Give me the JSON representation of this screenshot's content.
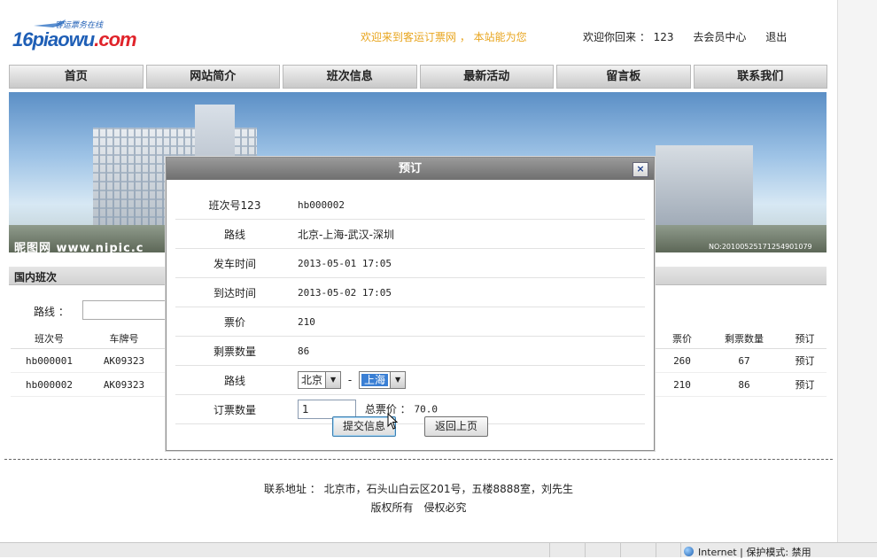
{
  "header": {
    "logo_main": "16piaowu",
    "logo_suffix": ".com",
    "logo_tagline": "客运票务在线",
    "welcome_text": "欢迎来到客运订票网 ， 本站能为您",
    "greeting": "欢迎你回来 ： 123",
    "member_center": "去会员中心",
    "logout": "退出"
  },
  "nav": [
    "首页",
    "网站简介",
    "班次信息",
    "最新活动",
    "留言板",
    "联系我们"
  ],
  "banner": {
    "watermark_left": "昵图网 www.nipic.c",
    "watermark_right": "NO:20100525171254901079"
  },
  "section": {
    "title": "国内班次",
    "route_label": "路线 ："
  },
  "table": {
    "headers": [
      "班次号",
      "车牌号",
      "票价",
      "剩票数量",
      "预订"
    ],
    "rows": [
      {
        "id": "hb000001",
        "plate": "AK09323",
        "price": "260",
        "remaining": "67",
        "book": "预订"
      },
      {
        "id": "hb000002",
        "plate": "AK09323",
        "price": "210",
        "remaining": "86",
        "book": "预订"
      }
    ]
  },
  "dialog": {
    "title": "预订",
    "close": "×",
    "fields": [
      {
        "label": "班次号123",
        "value": "hb000002"
      },
      {
        "label": "路线",
        "value": "北京-上海-武汉-深圳"
      },
      {
        "label": "发车时间",
        "value": "2013-05-01 17:05"
      },
      {
        "label": "到达时间",
        "value": "2013-05-02 17:05"
      },
      {
        "label": "票价",
        "value": "210"
      },
      {
        "label": "剩票数量",
        "value": "86"
      }
    ],
    "route_label": "路线",
    "route_from": "北京",
    "route_sep": "-",
    "route_to": "上海",
    "qty_label": "订票数量",
    "qty_value": "1",
    "total_label": "总票价 ：",
    "total_value": "70.0",
    "submit": "提交信息",
    "back": "返回上页"
  },
  "footer": {
    "address": "联系地址 ： 北京市，石头山白云区201号，五楼8888室，刘先生",
    "copyright": "版权所有　侵权必究"
  },
  "statusbar": {
    "zone": "Internet | 保护模式: 禁用"
  }
}
